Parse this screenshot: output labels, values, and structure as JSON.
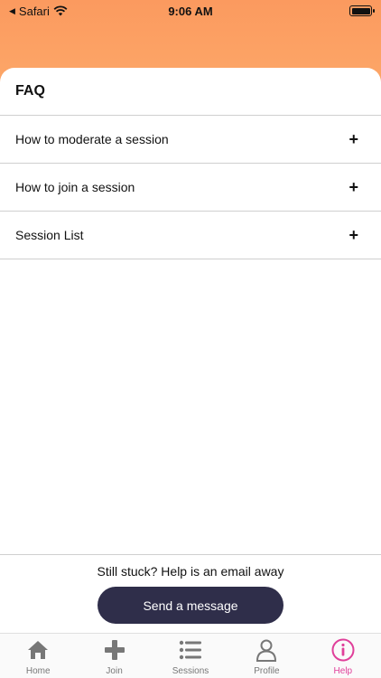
{
  "status_bar": {
    "carrier": "Safari",
    "time": "9:06 AM"
  },
  "faq": {
    "title": "FAQ",
    "items": [
      {
        "label": "How to moderate a session",
        "expand": "+"
      },
      {
        "label": "How to join a session",
        "expand": "+"
      },
      {
        "label": "Session List",
        "expand": "+"
      }
    ]
  },
  "footer": {
    "text": "Still stuck? Help is an email away",
    "button_label": "Send a message"
  },
  "tabs": [
    {
      "label": "Home",
      "icon": "home-icon"
    },
    {
      "label": "Join",
      "icon": "plus-icon"
    },
    {
      "label": "Sessions",
      "icon": "list-icon"
    },
    {
      "label": "Profile",
      "icon": "user-icon"
    },
    {
      "label": "Help",
      "icon": "info-icon",
      "active": true
    }
  ],
  "colors": {
    "header": "#fb9a5f",
    "button": "#2f2e4a",
    "active_tab": "#e0409a",
    "inactive_tab": "#777777"
  }
}
